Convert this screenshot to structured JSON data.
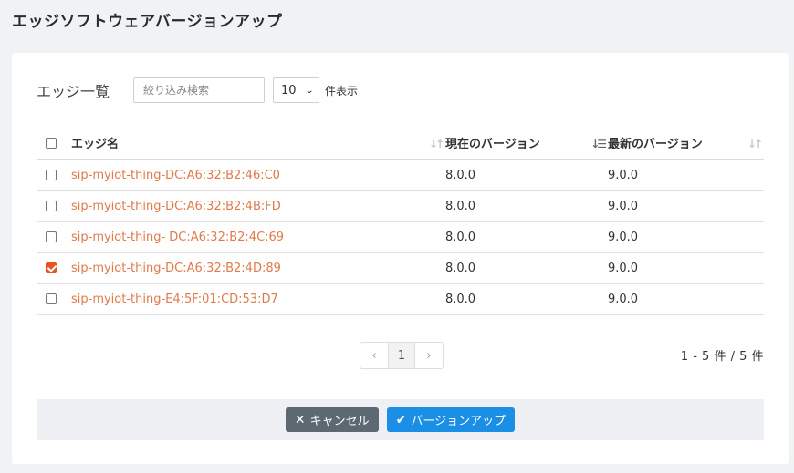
{
  "page_title": "エッジソフトウェアバージョンアップ",
  "list": {
    "title": "エッジ一覧",
    "search_placeholder": "絞り込み検索",
    "page_size": "10",
    "page_size_suffix": "件表示"
  },
  "table": {
    "headers": {
      "name": "エッジ名",
      "current": "現在のバージョン",
      "latest": "最新のバージョン"
    },
    "rows": [
      {
        "name": "sip-myiot-thing-DC:A6:32:B2:46:C0",
        "current": "8.0.0",
        "latest": "9.0.0",
        "checked": false
      },
      {
        "name": "sip-myiot-thing-DC:A6:32:B2:4B:FD",
        "current": "8.0.0",
        "latest": "9.0.0",
        "checked": false
      },
      {
        "name": "sip-myiot-thing- DC:A6:32:B2:4C:69",
        "current": "8.0.0",
        "latest": "9.0.0",
        "checked": false
      },
      {
        "name": "sip-myiot-thing-DC:A6:32:B2:4D:89",
        "current": "8.0.0",
        "latest": "9.0.0",
        "checked": true
      },
      {
        "name": "sip-myiot-thing-E4:5F:01:CD:53:D7",
        "current": "8.0.0",
        "latest": "9.0.0",
        "checked": false
      }
    ]
  },
  "pagination": {
    "prev": "‹",
    "current": "1",
    "next": "›",
    "count": "1 - 5 件 / 5 件"
  },
  "footer": {
    "cancel_label": "キャンセル",
    "update_label": "バージョンアップ"
  },
  "colors": {
    "accent": "#e8541e",
    "link": "#e07a4a",
    "primary": "#1b8ee6",
    "secondary": "#5c6872"
  },
  "icons": {
    "cancel": "close-icon",
    "update": "check-icon",
    "sort": "sort-icon"
  }
}
